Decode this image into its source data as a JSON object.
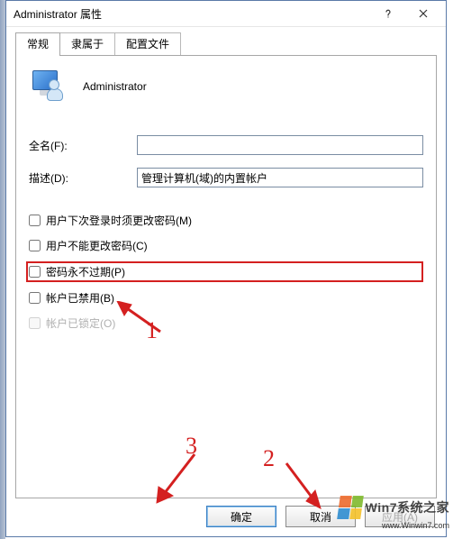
{
  "window": {
    "title": "Administrator 属性",
    "help_tooltip": "?",
    "close_tooltip": "×"
  },
  "tabs": [
    {
      "label": "常规",
      "active": true
    },
    {
      "label": "隶属于",
      "active": false
    },
    {
      "label": "配置文件",
      "active": false
    }
  ],
  "user": {
    "display_name": "Administrator"
  },
  "fields": {
    "full_name": {
      "label": "全名(F):",
      "value": ""
    },
    "description": {
      "label": "描述(D):",
      "value": "管理计算机(域)的内置帐户"
    }
  },
  "checkboxes": {
    "must_change": {
      "label": "用户下次登录时须更改密码(M)",
      "checked": false,
      "enabled": true
    },
    "cannot_change": {
      "label": "用户不能更改密码(C)",
      "checked": false,
      "enabled": true
    },
    "never_expire": {
      "label": "密码永不过期(P)",
      "checked": false,
      "enabled": true
    },
    "disabled": {
      "label": "帐户已禁用(B)",
      "checked": false,
      "enabled": true
    },
    "locked": {
      "label": "帐户已锁定(O)",
      "checked": false,
      "enabled": false
    }
  },
  "buttons": {
    "ok": {
      "label": "确定"
    },
    "cancel": {
      "label": "取消"
    },
    "apply": {
      "label": "应用(A)"
    }
  },
  "annotations": {
    "one": "1",
    "two": "2",
    "three": "3"
  },
  "watermark": {
    "brand": "Win7系统之家",
    "url": "www.Winwin7.com"
  }
}
